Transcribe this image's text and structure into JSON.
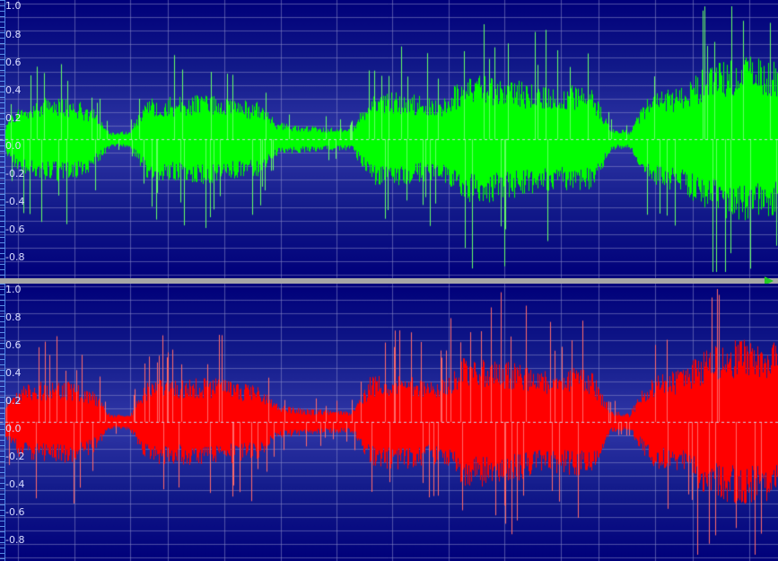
{
  "editor": {
    "view": "stereo-waveform",
    "colors": {
      "background_center": "#3138a8",
      "background_edge": "#00007a",
      "grid": "#8a8cc8",
      "zero_line": "#d0d0e0",
      "left_channel": "#00ff00",
      "left_channel_highlight": "#66ff66",
      "right_channel": "#ff0000",
      "right_channel_highlight": "#ff6a6a",
      "divider": "#a6a6a6",
      "playhead": "#22cc22"
    },
    "amplitude_scale": [
      "1.0",
      "0.8",
      "0.6",
      "0.4",
      "0.2",
      "0.0",
      "-0.2",
      "-0.4",
      "-0.6",
      "-0.8"
    ],
    "channels": [
      {
        "id": "left",
        "color_key": "left_channel"
      },
      {
        "id": "right",
        "color_key": "right_channel"
      }
    ],
    "envelope": [
      0.05,
      0.25,
      0.28,
      0.3,
      0.28,
      0.22,
      0.05,
      0.06,
      0.3,
      0.3,
      0.3,
      0.32,
      0.3,
      0.28,
      0.26,
      0.12,
      0.1,
      0.09,
      0.08,
      0.08,
      0.32,
      0.34,
      0.33,
      0.3,
      0.3,
      0.45,
      0.46,
      0.44,
      0.42,
      0.38,
      0.36,
      0.38,
      0.36,
      0.08,
      0.06,
      0.3,
      0.35,
      0.38,
      0.5,
      0.55,
      0.6,
      0.58,
      0.56
    ]
  }
}
